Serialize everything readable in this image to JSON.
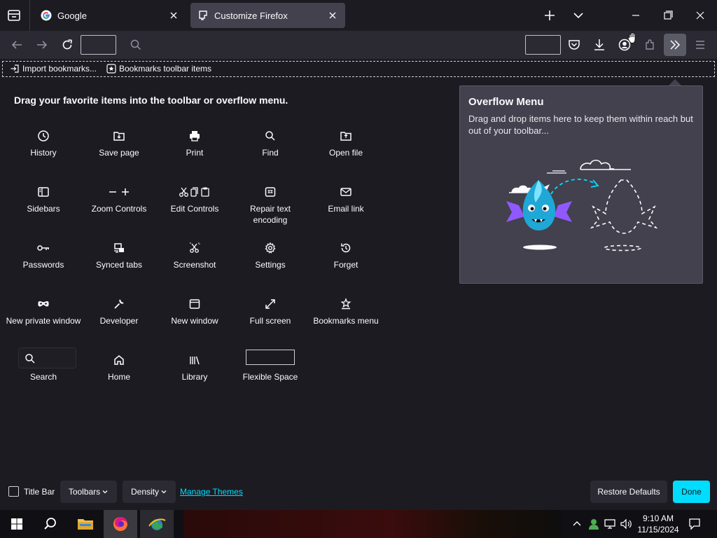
{
  "tabs": [
    {
      "title": "Google",
      "favicon": "google-g-icon"
    },
    {
      "title": "Customize Firefox",
      "favicon": "puzzle-icon",
      "active": true
    }
  ],
  "bookmarks_bar": {
    "items": [
      {
        "label": "Import bookmarks...",
        "icon": "import-icon"
      },
      {
        "label": "Bookmarks toolbar items",
        "icon": "bookmark-star-icon"
      }
    ]
  },
  "palette": {
    "heading": "Drag your favorite items into the toolbar or overflow menu.",
    "items": [
      {
        "label": "History",
        "icon": "clock-icon"
      },
      {
        "label": "Save page",
        "icon": "save-page-icon"
      },
      {
        "label": "Print",
        "icon": "printer-icon"
      },
      {
        "label": "Find",
        "icon": "magnifier-icon"
      },
      {
        "label": "Open file",
        "icon": "folder-icon"
      },
      {
        "label": "Sidebars",
        "icon": "sidebar-icon"
      },
      {
        "label": "Zoom Controls",
        "icon": "zoom-icon"
      },
      {
        "label": "Edit Controls",
        "icon": "cut-copy-paste-icon"
      },
      {
        "label": "Repair text encoding",
        "icon": "text-encoding-icon"
      },
      {
        "label": "Email link",
        "icon": "envelope-icon"
      },
      {
        "label": "Passwords",
        "icon": "key-icon"
      },
      {
        "label": "Synced tabs",
        "icon": "synced-tabs-icon"
      },
      {
        "label": "Screenshot",
        "icon": "screenshot-icon"
      },
      {
        "label": "Settings",
        "icon": "gear-icon"
      },
      {
        "label": "Forget",
        "icon": "forget-icon"
      },
      {
        "label": "New private window",
        "icon": "mask-icon"
      },
      {
        "label": "Developer",
        "icon": "wrench-icon"
      },
      {
        "label": "New window",
        "icon": "window-icon"
      },
      {
        "label": "Full screen",
        "icon": "fullscreen-icon"
      },
      {
        "label": "Bookmarks menu",
        "icon": "bookmarks-menu-icon"
      },
      {
        "label": "Search",
        "icon": "search-icon"
      },
      {
        "label": "Home",
        "icon": "home-icon"
      },
      {
        "label": "Library",
        "icon": "library-icon"
      },
      {
        "label": "Flexible Space",
        "icon": "flexible-space"
      }
    ]
  },
  "overflow_menu": {
    "title": "Overflow Menu",
    "description": "Drag and drop items here to keep them within reach but out of your toolbar..."
  },
  "footer": {
    "title_bar_label": "Title Bar",
    "title_bar_checked": false,
    "toolbars_label": "Toolbars",
    "density_label": "Density",
    "manage_themes_label": "Manage Themes",
    "restore_defaults_label": "Restore Defaults",
    "done_label": "Done"
  },
  "taskbar": {
    "time": "9:10 AM",
    "date": "11/15/2024"
  },
  "colors": {
    "accent": "#00ddff",
    "background": "#1c1b22",
    "toolbar": "#2b2a33",
    "panel": "#42414d"
  }
}
